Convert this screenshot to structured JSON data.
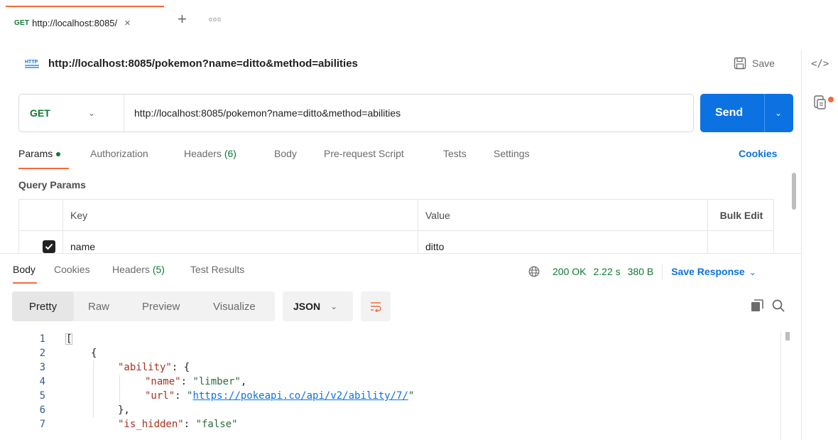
{
  "tab": {
    "method": "GET",
    "title": "http://localhost:8085/",
    "close": "×",
    "new_tab": "+",
    "more": "ooo"
  },
  "request": {
    "title": "http://localhost:8085/pokemon?name=ditto&method=abilities",
    "save_label": "Save",
    "method": "GET",
    "url": "http://localhost:8085/pokemon?name=ditto&method=abilities",
    "send_label": "Send"
  },
  "request_tabs": [
    {
      "label": "Params",
      "active": true
    },
    {
      "label": "Authorization"
    },
    {
      "label": "Headers",
      "count": "(6)"
    },
    {
      "label": "Body"
    },
    {
      "label": "Pre-request Script"
    },
    {
      "label": "Tests"
    },
    {
      "label": "Settings"
    }
  ],
  "cookies_label": "Cookies",
  "query_params": {
    "title": "Query Params",
    "headers": {
      "key": "Key",
      "value": "Value",
      "bulk": "Bulk Edit"
    },
    "rows": [
      {
        "key": "name",
        "value": "ditto",
        "checked": true
      }
    ]
  },
  "response": {
    "tabs": [
      {
        "label": "Body",
        "active": true
      },
      {
        "label": "Cookies"
      },
      {
        "label": "Headers",
        "count": "(5)"
      },
      {
        "label": "Test Results"
      }
    ],
    "status": "200 OK",
    "time": "2.22 s",
    "size": "380 B",
    "save_label": "Save Response",
    "view_tabs": [
      "Pretty",
      "Raw",
      "Preview",
      "Visualize"
    ],
    "format": "JSON",
    "lines": [
      "1",
      "2",
      "3",
      "4",
      "5",
      "6",
      "7"
    ],
    "code": {
      "l1": "[",
      "l2": "{",
      "l3_key": "\"ability\"",
      "l3_rest": ": {",
      "l4_key": "\"name\"",
      "l4_val": "\"limber\"",
      "l5_key": "\"url\"",
      "l5_url": "https://pokeapi.co/api/v2/ability/7/",
      "l6": "},",
      "l7_key": "\"is_hidden\"",
      "l7_val": "\"false\""
    }
  },
  "colors": {
    "accent": "#f26b3a",
    "primary": "#0c72e2",
    "success": "#0c7a32"
  },
  "icons": [
    "http-icon",
    "save-icon",
    "code-icon",
    "doc-icon",
    "globe-icon",
    "copy-icon",
    "search-icon",
    "wrap-icon"
  ]
}
